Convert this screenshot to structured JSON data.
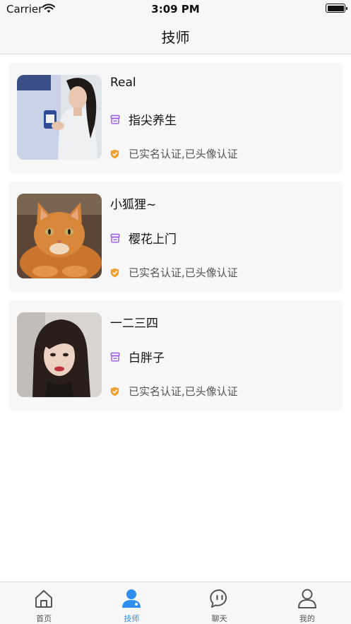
{
  "status_bar": {
    "carrier": "Carrier",
    "time": "3:09 PM"
  },
  "nav": {
    "title": "技师"
  },
  "technicians": [
    {
      "name": "Real",
      "shop": "指尖养生",
      "verification": "已实名认证,已头像认证",
      "avatar": "woman-poster-photo"
    },
    {
      "name": "小狐狸~",
      "shop": "樱花上门",
      "verification": "已实名认证,已头像认证",
      "avatar": "orange-cat-photo"
    },
    {
      "name": "一二三四",
      "shop": "白胖子",
      "verification": "已实名认证,已头像认证",
      "avatar": "woman-portrait-photo"
    }
  ],
  "tabs": [
    {
      "label": "首页",
      "icon": "home-icon",
      "active": false
    },
    {
      "label": "技师",
      "icon": "person-icon",
      "active": true
    },
    {
      "label": "聊天",
      "icon": "chat-icon",
      "active": false
    },
    {
      "label": "我的",
      "icon": "profile-icon",
      "active": false
    }
  ],
  "colors": {
    "accent": "#2e8ff0",
    "shop_icon": "#9b59e8",
    "verify_icon": "#f0a030",
    "card_background": "#f7f7f7"
  }
}
